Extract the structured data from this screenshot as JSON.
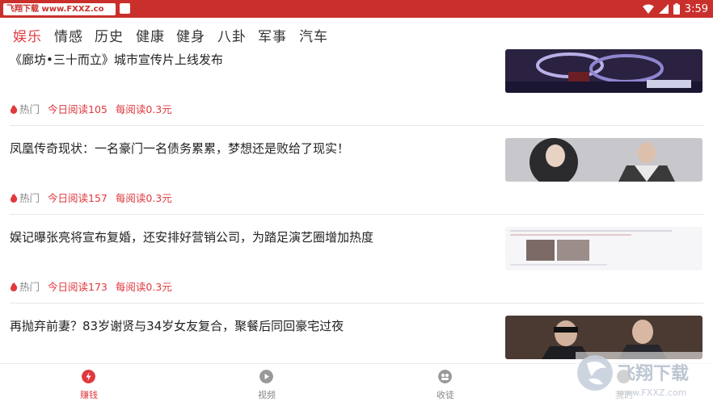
{
  "status_bar": {
    "badge": "飞翔下载 www.FXXZ.com",
    "time": "3:59",
    "bar_color": "#c9302c"
  },
  "tabs": [
    {
      "label": "娱乐",
      "active": true
    },
    {
      "label": "情感",
      "active": false
    },
    {
      "label": "历史",
      "active": false
    },
    {
      "label": "健康",
      "active": false
    },
    {
      "label": "健身",
      "active": false
    },
    {
      "label": "八卦",
      "active": false
    },
    {
      "label": "军事",
      "active": false
    },
    {
      "label": "汽车",
      "active": false
    }
  ],
  "articles": [
    {
      "title": "《廊坊•三十而立》城市宣传片上线发布",
      "hot": "热门",
      "reads": "今日阅读105",
      "price": "每阅读0.3元"
    },
    {
      "title": "凤凰传奇现状：一名豪门一名债务累累，梦想还是败给了现实！",
      "hot": "热门",
      "reads": "今日阅读157",
      "price": "每阅读0.3元"
    },
    {
      "title": "娱记曝张亮将宣布复婚，还安排好营销公司，为踏足演艺圈增加热度",
      "hot": "热门",
      "reads": "今日阅读173",
      "price": "每阅读0.3元"
    },
    {
      "title": "再抛弃前妻？83岁谢贤与34岁女友复合，聚餐后同回豪宅过夜",
      "hot": "",
      "reads": "",
      "price": ""
    }
  ],
  "bottom_nav": [
    {
      "label": "赚钱",
      "icon": "lightning-icon",
      "active": true
    },
    {
      "label": "视频",
      "icon": "play-icon",
      "active": false
    },
    {
      "label": "收徒",
      "icon": "people-icon",
      "active": false
    },
    {
      "label": "我的",
      "icon": "user-icon",
      "active": false
    }
  ],
  "watermark": {
    "logo": "飞翔下载",
    "url": "www.FXXZ.com"
  },
  "accent_color": "#e0393e"
}
